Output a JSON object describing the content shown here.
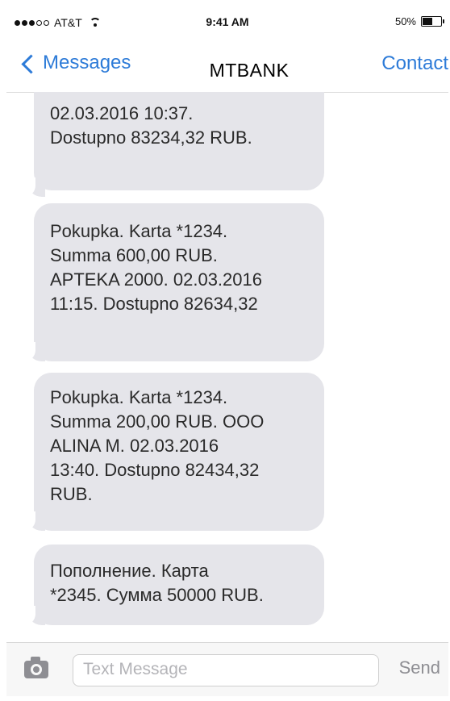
{
  "status_bar": {
    "carrier": "AT&T",
    "time": "9:41 AM",
    "battery": "50%",
    "battery_level": 0.5
  },
  "nav": {
    "back_label": "Messages",
    "title": "MTBANK",
    "contact_label": "Contact"
  },
  "messages": [
    {
      "lines": [
        "02.03.2016 10:37.",
        "Dostupno 83234,32 RUB."
      ]
    },
    {
      "lines": [
        "Pokupka. Karta *1234.",
        "Summa 600,00 RUB.",
        "APTEKA 2000. 02.03.2016",
        "11:15. Dostupno 82634,32"
      ]
    },
    {
      "lines": [
        "Pokupka. Karta *1234.",
        "Summa 200,00 RUB. OOO",
        "ALINA M. 02.03.2016",
        "13:40. Dostupno 82434,32",
        "RUB."
      ]
    },
    {
      "lines": [
        "Пополнение. Карта",
        "*2345. Сумма 50000 RUB."
      ]
    }
  ],
  "input_bar": {
    "placeholder": "Text Message",
    "send_label": "Send"
  },
  "colors": {
    "accent": "#2d7bd8",
    "bubble": "#e5e5ea"
  }
}
